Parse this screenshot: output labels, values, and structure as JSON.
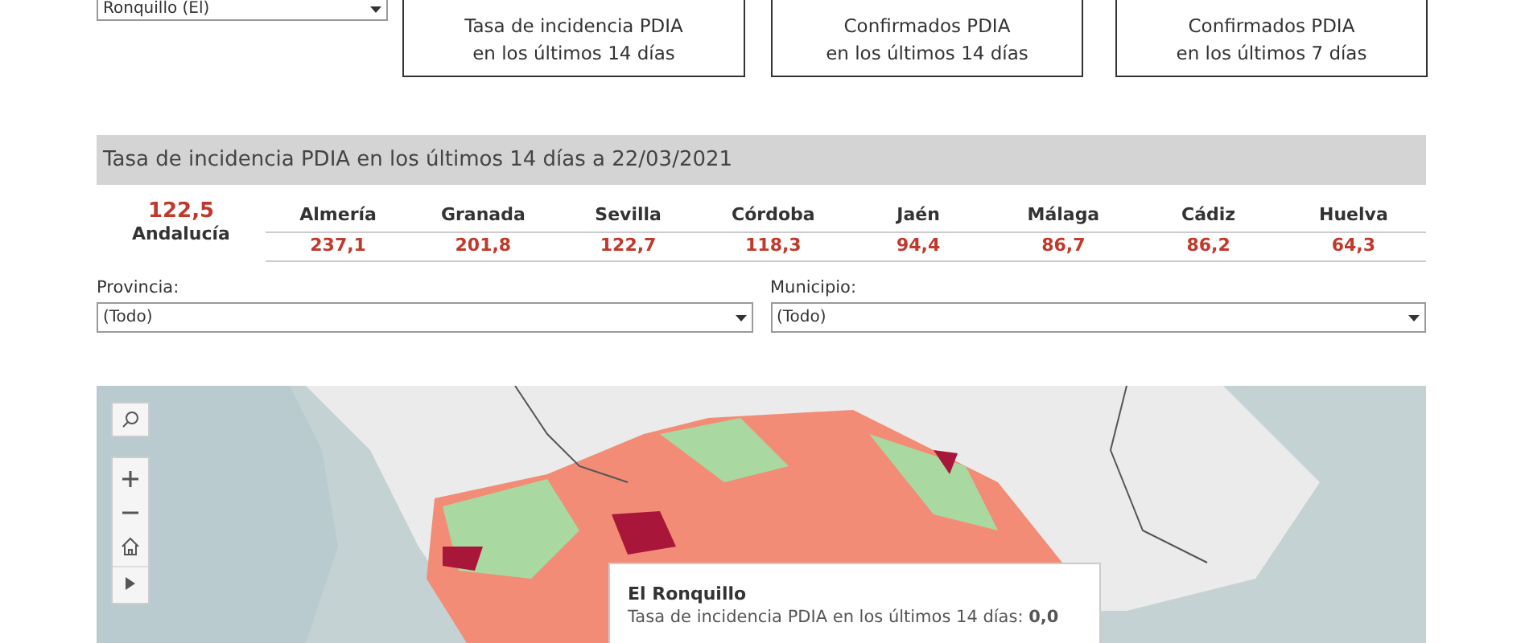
{
  "municipio_filter_top": {
    "value": "Ronquillo (El)"
  },
  "kpi_cards": [
    {
      "label": "Tasa de incidencia PDIA\nen los últimos 14 días"
    },
    {
      "label": "Confirmados PDIA\nen los últimos 14 días"
    },
    {
      "label": "Confirmados PDIA\nen los últimos 7 días"
    }
  ],
  "section_title": "Tasa de incidencia PDIA en los últimos 14 días a 22/03/2021",
  "region_total": {
    "value": "122,5",
    "name": "Andalucía"
  },
  "provinces": [
    {
      "name": "Almería",
      "value": "237,1"
    },
    {
      "name": "Granada",
      "value": "201,8"
    },
    {
      "name": "Sevilla",
      "value": "122,7"
    },
    {
      "name": "Córdoba",
      "value": "118,3"
    },
    {
      "name": "Jaén",
      "value": "94,4"
    },
    {
      "name": "Málaga",
      "value": "86,7"
    },
    {
      "name": "Cádiz",
      "value": "86,2"
    },
    {
      "name": "Huelva",
      "value": "64,3"
    }
  ],
  "filters": [
    {
      "label": "Provincia:",
      "value": "(Todo)"
    },
    {
      "label": "Municipio:",
      "value": "(Todo)"
    }
  ],
  "map": {
    "tooltip": {
      "title": "El Ronquillo",
      "lines": [
        "Tasa de incidencia PDIA en los últimos 14 días: **0,0**"
      ]
    }
  }
}
